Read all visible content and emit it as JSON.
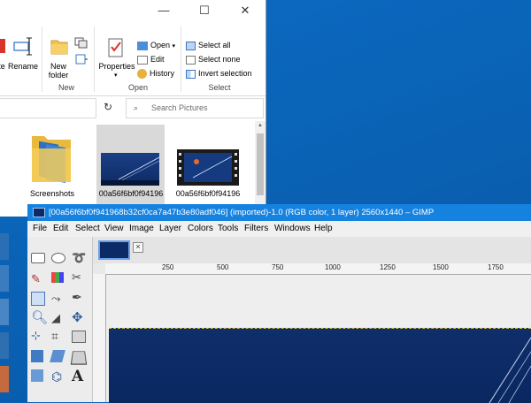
{
  "explorer": {
    "ribbon": {
      "rename_label": "Rename",
      "new_folder_label": "New\nfolder",
      "properties_label": "Properties",
      "open_label": "Open",
      "edit_label": "Edit",
      "history_label": "History",
      "select_all_label": "Select all",
      "select_none_label": "Select none",
      "invert_selection_label": "Invert selection",
      "groups": {
        "new": "New",
        "open": "Open",
        "select": "Select"
      }
    },
    "search": {
      "placeholder": "Search Pictures"
    },
    "files": [
      {
        "name": "Screenshots"
      },
      {
        "name": "00a56f6bf0f94196"
      },
      {
        "name": "00a56f6bf0f94196"
      }
    ]
  },
  "gimp": {
    "title": "[00a56f6bf0f941968b32cf0ca7a47b3e80adf046] (imported)-1.0 (RGB color, 1 layer) 2560x1440 – GIMP",
    "menu": [
      "File",
      "Edit",
      "Select",
      "View",
      "Image",
      "Layer",
      "Colors",
      "Tools",
      "Filters",
      "Windows",
      "Help"
    ],
    "ruler_labels": [
      "250",
      "500",
      "750",
      "1000",
      "1250",
      "1500",
      "1750"
    ],
    "tab_close": "×"
  },
  "colors": {
    "desktop": "#0a63b8",
    "gimp_titlebar": "#1682e0",
    "image_blue": "#0c2b66"
  }
}
